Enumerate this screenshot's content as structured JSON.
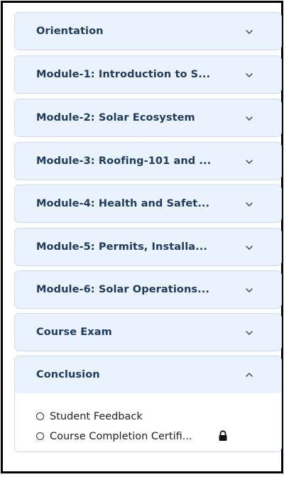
{
  "modules": [
    {
      "title": "Orientation",
      "expanded": false
    },
    {
      "title": "Module-1: Introduction to S...",
      "expanded": false
    },
    {
      "title": "Module-2: Solar Ecosystem",
      "expanded": false
    },
    {
      "title": "Module-3: Roofing-101 and ...",
      "expanded": false
    },
    {
      "title": "Module-4: Health and Safet...",
      "expanded": false
    },
    {
      "title": "Module-5: Permits, Installa...",
      "expanded": false
    },
    {
      "title": "Module-6: Solar Operations...",
      "expanded": false
    },
    {
      "title": "Course Exam",
      "expanded": false
    },
    {
      "title": "Conclusion",
      "expanded": true
    }
  ],
  "conclusion_lessons": [
    {
      "label": "Student Feedback",
      "locked": false
    },
    {
      "label": "Course Completion Certifi...",
      "locked": true
    }
  ],
  "icons": {
    "collapsed": "chevron-down-icon",
    "expanded": "chevron-up-icon",
    "lesson_status": "radio-circle-icon",
    "locked": "lock-icon"
  },
  "colors": {
    "header_bg": "#eaf2fd",
    "header_border": "#c9dcf3",
    "title_text": "#1e3a5f"
  }
}
